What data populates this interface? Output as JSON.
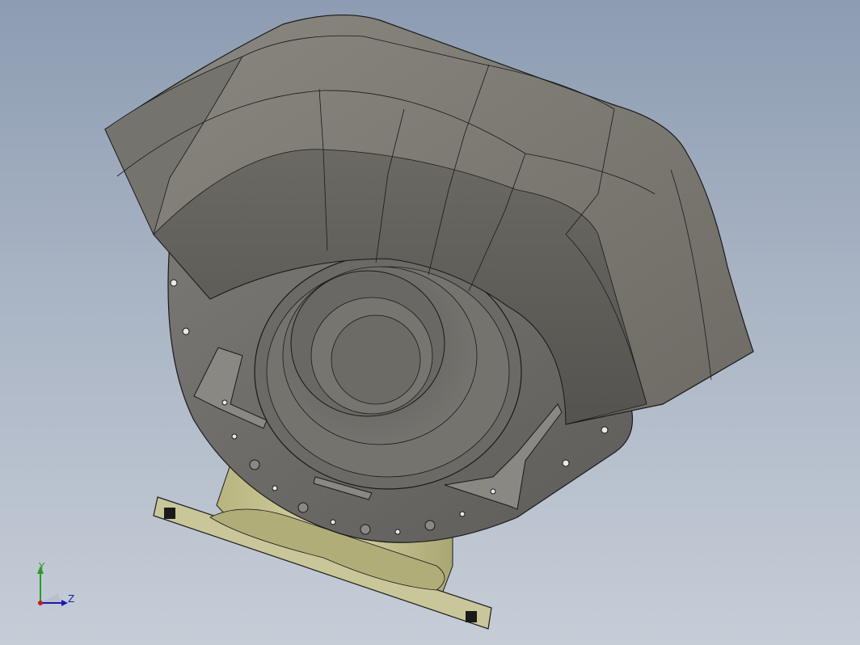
{
  "viewport": {
    "background_top": "#8d9cb2",
    "background_bottom": "#c6cdd7"
  },
  "model": {
    "housing_color": "#6f6f6a",
    "outlet_color": "#c9c79a",
    "edge_color": "#1a1a1a"
  },
  "triad": {
    "x_axis_color": "#1a1ab0",
    "y_axis_color": "#2a9a2a",
    "origin_color": "#c02020",
    "y_label": "Y",
    "z_label": "Z"
  }
}
